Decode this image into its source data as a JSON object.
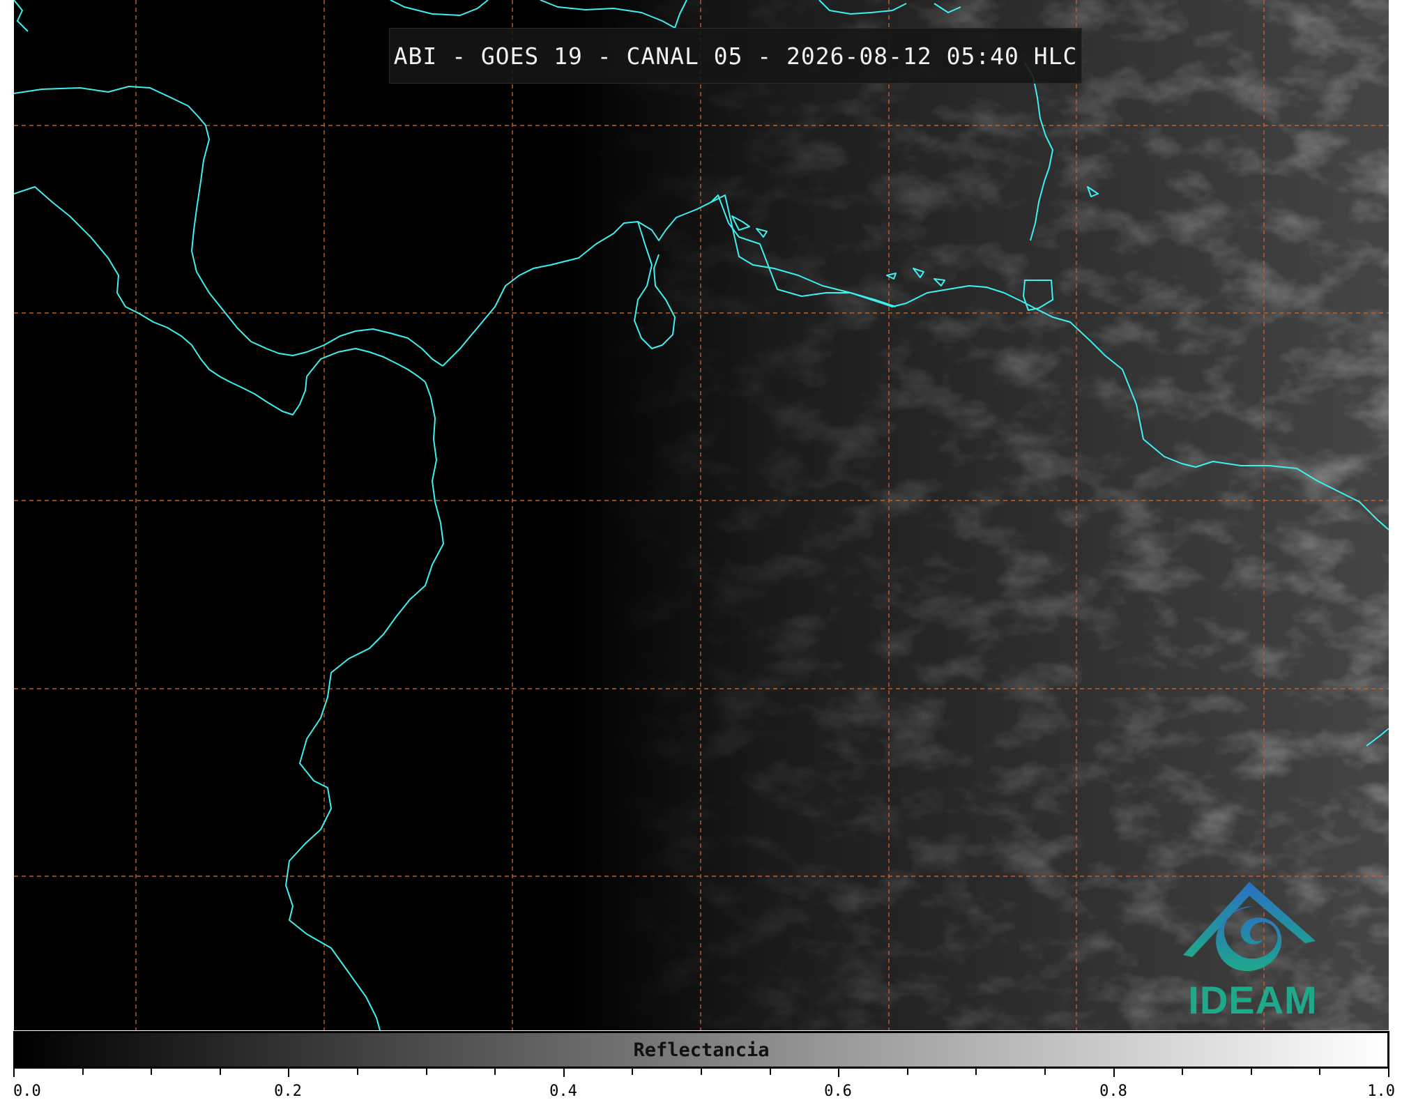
{
  "title": "ABI - GOES 19 - CANAL 05 - 2026-08-12 05:40 HLC",
  "colorbar": {
    "label": "Reflectancia",
    "min": 0.0,
    "max": 1.0,
    "ticks": [
      {
        "value": 0.0,
        "label": "0.0"
      },
      {
        "value": 0.2,
        "label": "0.2"
      },
      {
        "value": 0.4,
        "label": "0.4"
      },
      {
        "value": 0.6,
        "label": "0.6"
      },
      {
        "value": 0.8,
        "label": "0.8"
      },
      {
        "value": 1.0,
        "label": "1.0"
      }
    ],
    "minor_step": 0.05,
    "colors": [
      "#000000",
      "#ffffff"
    ]
  },
  "map": {
    "background_color": "#000000",
    "coastline_color": "#3ff0f0",
    "grid_color": "#c0602a",
    "grid_style": "dashed"
  },
  "logo": {
    "text": "IDEAM",
    "colors": [
      "#2b6fc4",
      "#1fa88a"
    ]
  }
}
